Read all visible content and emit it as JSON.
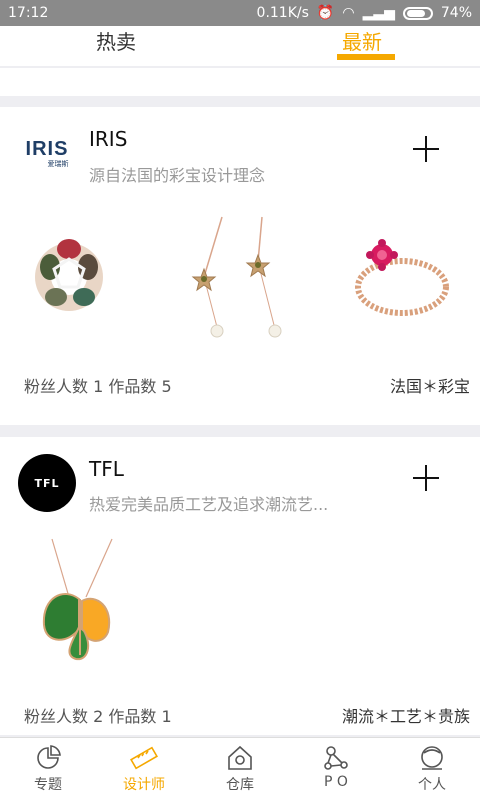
{
  "status": {
    "time": "17:12",
    "speed": "0.11K/s",
    "battery": "74%"
  },
  "tabs": {
    "hot": "热卖",
    "new": "最新"
  },
  "designers": [
    {
      "name": "IRIS",
      "logo_text": "IRIS",
      "logo_sub": "爱瑞斯",
      "desc": "源自法国的彩宝设计理念",
      "stats": "粉丝人数 1  作品数 5",
      "tags": "法国＊彩宝"
    },
    {
      "name": "TFL",
      "logo_text": "TFL",
      "desc": "热爱完美品质工艺及追求潮流艺...",
      "stats": "粉丝人数 2  作品数 1",
      "tags": "潮流＊工艺＊贵族"
    }
  ],
  "nav": [
    {
      "label": "专题",
      "icon": "pie-chart-icon"
    },
    {
      "label": "设计师",
      "icon": "ruler-icon"
    },
    {
      "label": "仓库",
      "icon": "house-icon"
    },
    {
      "label": "P O",
      "icon": "molecule-icon"
    },
    {
      "label": "个人",
      "icon": "person-icon"
    }
  ],
  "colors": {
    "accent": "#f5a800"
  }
}
